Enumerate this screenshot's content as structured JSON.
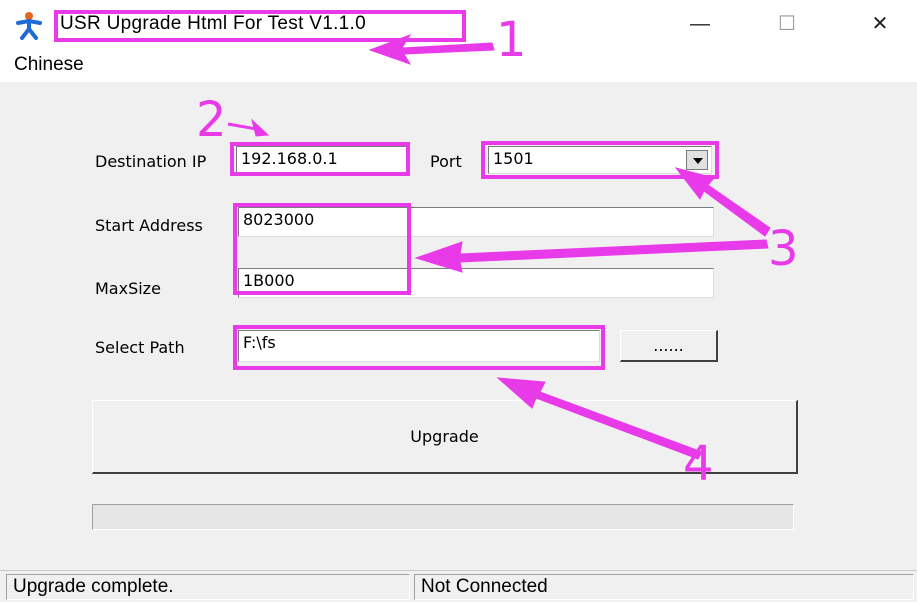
{
  "window": {
    "title": "USR Upgrade Html For Test V1.1.0",
    "minimize_glyph": "—",
    "maximize_glyph": "☐",
    "close_glyph": "✕",
    "app_icon": "running-person-icon"
  },
  "menu": {
    "items": [
      {
        "label": "Chinese"
      }
    ]
  },
  "form": {
    "destination_ip": {
      "label": "Destination IP",
      "value": "192.168.0.1"
    },
    "port": {
      "label": "Port",
      "value": "1501"
    },
    "start_address": {
      "label": "Start Address",
      "value": "8023000"
    },
    "max_size": {
      "label": "MaxSize",
      "value": "1B000"
    },
    "select_path": {
      "label": "Select Path",
      "value": "F:\\fs"
    },
    "browse_label": "......",
    "upgrade_label": "Upgrade",
    "progress": 0
  },
  "status": {
    "left": "Upgrade complete.",
    "right": "Not Connected"
  },
  "annotations": {
    "color": "#e83ae8",
    "numbers": [
      "1",
      "2",
      "3",
      "4"
    ]
  }
}
